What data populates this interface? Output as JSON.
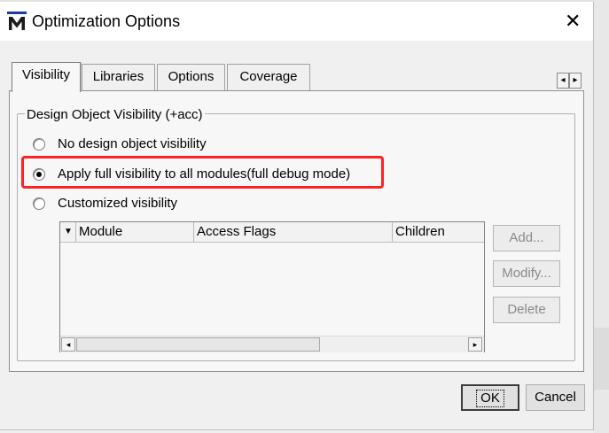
{
  "window": {
    "title": "Optimization Options",
    "app_icon_letter": "M",
    "close_glyph": "✕",
    "icon": "app-logo-icon"
  },
  "tabs": [
    {
      "label": "Visibility",
      "active": true
    },
    {
      "label": "Libraries",
      "active": false
    },
    {
      "label": "Options",
      "active": false
    },
    {
      "label": "Coverage",
      "active": false
    }
  ],
  "tab_scroll": {
    "left": "◂",
    "right": "▸"
  },
  "group": {
    "title": "Design Object Visibility (+acc)",
    "options": [
      {
        "label": "No design object visibility",
        "selected": false
      },
      {
        "label": "Apply full visibility to all modules(full debug mode)",
        "selected": true
      },
      {
        "label": "Customized visibility",
        "selected": false
      }
    ],
    "table": {
      "sort_glyph": "▼",
      "columns": [
        "Module",
        "Access Flags",
        "Children"
      ],
      "rows": []
    },
    "scroll": {
      "left": "◂",
      "right": "▸"
    },
    "buttons": {
      "add": "Add...",
      "modify": "Modify...",
      "delete": "Delete"
    }
  },
  "footer": {
    "ok": "OK",
    "cancel": "Cancel"
  },
  "colors": {
    "highlight": "#ff2222",
    "logo_blue": "#1a3f9a"
  }
}
